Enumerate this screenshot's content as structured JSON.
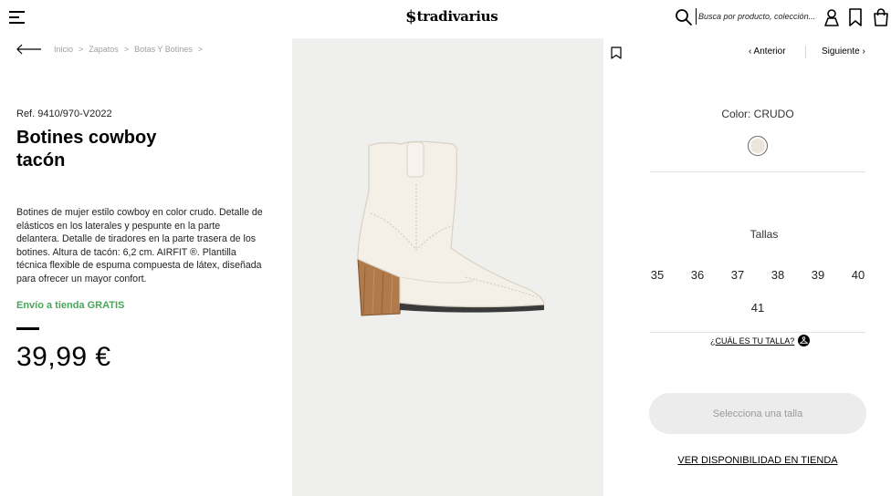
{
  "header": {
    "logo_mark": "$",
    "logo_text": "tradivarius",
    "search_placeholder": "Busca por producto, colección..."
  },
  "breadcrumb": [
    "Inicio",
    "Zapatos",
    "Botas Y Botines"
  ],
  "breadcrumb_sep": ">",
  "product": {
    "ref": "Ref. 9410/970-V2022",
    "title": "Botines cowboy tacón",
    "description": "Botines de mujer estilo cowboy en color crudo. Detalle de elásticos en los laterales y pespunte en la parte delantera. Detalle de tiradores en la parte trasera de los botines. Altura de tacón: 6,2 cm. AIRFIT ®. Plantilla técnica flexible de espuma compuesta de látex, diseñada para ofrecer un mayor confort.",
    "shipping": "Envío a tienda GRATIS",
    "price": "39,99 €"
  },
  "nav": {
    "prev": "‹ Anterior",
    "next": "Siguiente ›"
  },
  "color": {
    "label": "Color: CRUDO",
    "swatch": "#ece5dc"
  },
  "sizes": {
    "title": "Tallas",
    "values": [
      "35",
      "36",
      "37",
      "38",
      "39",
      "40",
      "41"
    ],
    "guide": "¿CUÁL ES TU TALLA?"
  },
  "actions": {
    "select_size": "Selecciona una talla",
    "store_availability": "VER DISPONIBILIDAD EN TIENDA"
  },
  "colors": {
    "accent_green": "#4aa657",
    "image_bg": "#efefee",
    "button_bg": "#ececec"
  }
}
